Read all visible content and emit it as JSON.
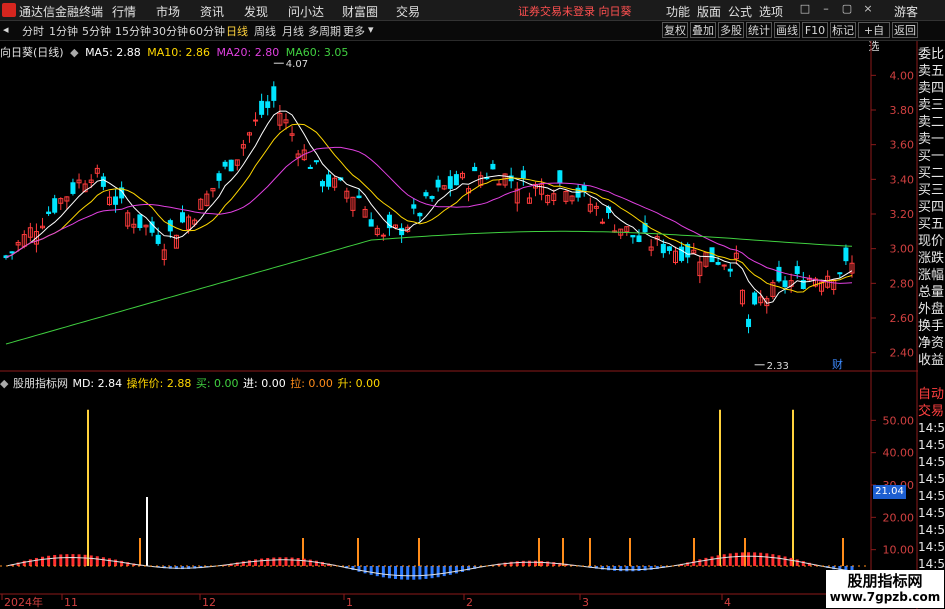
{
  "menubar": {
    "app_title": "通达信金融终端",
    "items": [
      "行情",
      "市场",
      "资讯",
      "发现",
      "问小达",
      "财富圈",
      "交易"
    ],
    "warning": "证券交易未登录 向日葵",
    "right_items": [
      "功能",
      "版面",
      "公式",
      "选项"
    ],
    "user": "游客"
  },
  "tabs": {
    "items": [
      "分时",
      "1分钟",
      "5分钟",
      "15分钟",
      "30分钟",
      "60分钟",
      "日线",
      "周线",
      "月线",
      "多周期",
      "更多"
    ],
    "active": "日线",
    "tools": [
      "复权",
      "叠加",
      "多股",
      "统计",
      "画线",
      "F10",
      "标记",
      "+自选"
    ],
    "back": "返回"
  },
  "quote": {
    "name": "向日葵(日线)",
    "ma5": "MA5: 2.88",
    "ma10": "MA10: 2.86",
    "ma20": "MA20: 2.80",
    "ma60": "MA60: 3.05",
    "ma5_color": "#ffffff",
    "ma10_color": "#ffd700",
    "ma20_color": "#e040e0",
    "ma60_color": "#40d040"
  },
  "indicator": {
    "name": "股朋指标网",
    "md": "MD: 2.84",
    "price": "操作价: 2.88",
    "buy": "买: 0.00",
    "in": "进: 0.00",
    "pull": "拉: 0.00",
    "rise": "升: 0.00"
  },
  "chart_data": {
    "type": "candlestick",
    "ylim": [
      2.3,
      4.1
    ],
    "yticks": [
      "4.00",
      "3.80",
      "3.60",
      "3.40",
      "3.20",
      "3.00",
      "2.80",
      "2.60",
      "2.40"
    ],
    "high_label": "4.07",
    "low_label": "2.33",
    "finance_mark": "财",
    "up_color": "#ff3c3c",
    "down_color": "#00e5ff",
    "indicator_ylim": [
      0,
      60
    ],
    "indicator_yticks": [
      "50.00",
      "40.00",
      "30.00",
      "20.00",
      "10.00"
    ],
    "indicator_value": "21.04",
    "x_labels": [
      "2024年",
      "11",
      "12",
      "1",
      "2",
      "3",
      "4"
    ]
  },
  "sidebar_top": [
    "委比",
    "卖五",
    "卖四",
    "卖三",
    "卖二",
    "卖一",
    "买一",
    "买二",
    "买三",
    "买四",
    "买五",
    "现价",
    "涨跌",
    "涨幅",
    "总量",
    "外盘",
    "换手",
    "净资",
    "收益"
  ],
  "sidebar_bottom": {
    "labels": [
      "自动",
      "交易"
    ],
    "times": [
      "14:5",
      "14:5",
      "14:5",
      "14:5",
      "14:5",
      "14:5",
      "14:5",
      "14:5",
      "14:5",
      "14:5"
    ]
  },
  "watermark": {
    "line1": "股朋指标网",
    "line2": "www.7gpzb.com"
  }
}
